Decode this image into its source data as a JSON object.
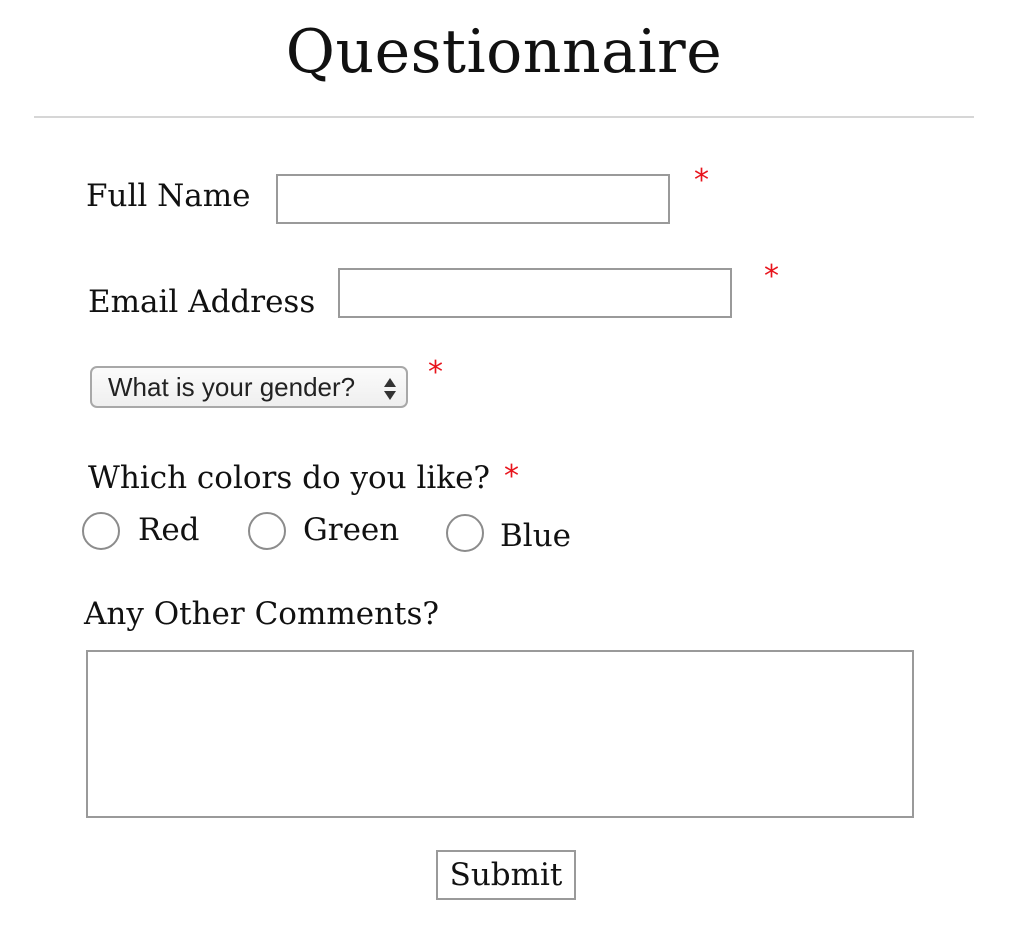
{
  "page": {
    "title": "Questionnaire"
  },
  "form": {
    "full_name": {
      "label": "Full Name",
      "value": "",
      "placeholder": "",
      "required_mark": "*"
    },
    "email": {
      "label": "Email Address",
      "value": "",
      "placeholder": "",
      "required_mark": "*"
    },
    "gender": {
      "selected": "What is your gender?",
      "required_mark": "*"
    },
    "colors": {
      "question": "Which colors do you like?",
      "required_mark": "*",
      "options": [
        {
          "label": "Red",
          "checked": false
        },
        {
          "label": "Green",
          "checked": false
        },
        {
          "label": "Blue",
          "checked": false
        }
      ]
    },
    "comments": {
      "label": "Any Other Comments?",
      "value": "",
      "placeholder": ""
    },
    "submit_label": "Submit"
  },
  "colors": {
    "required": "#e8141c",
    "border": "#9a9a9a",
    "divider": "#d6d6d6",
    "text": "#111111"
  }
}
